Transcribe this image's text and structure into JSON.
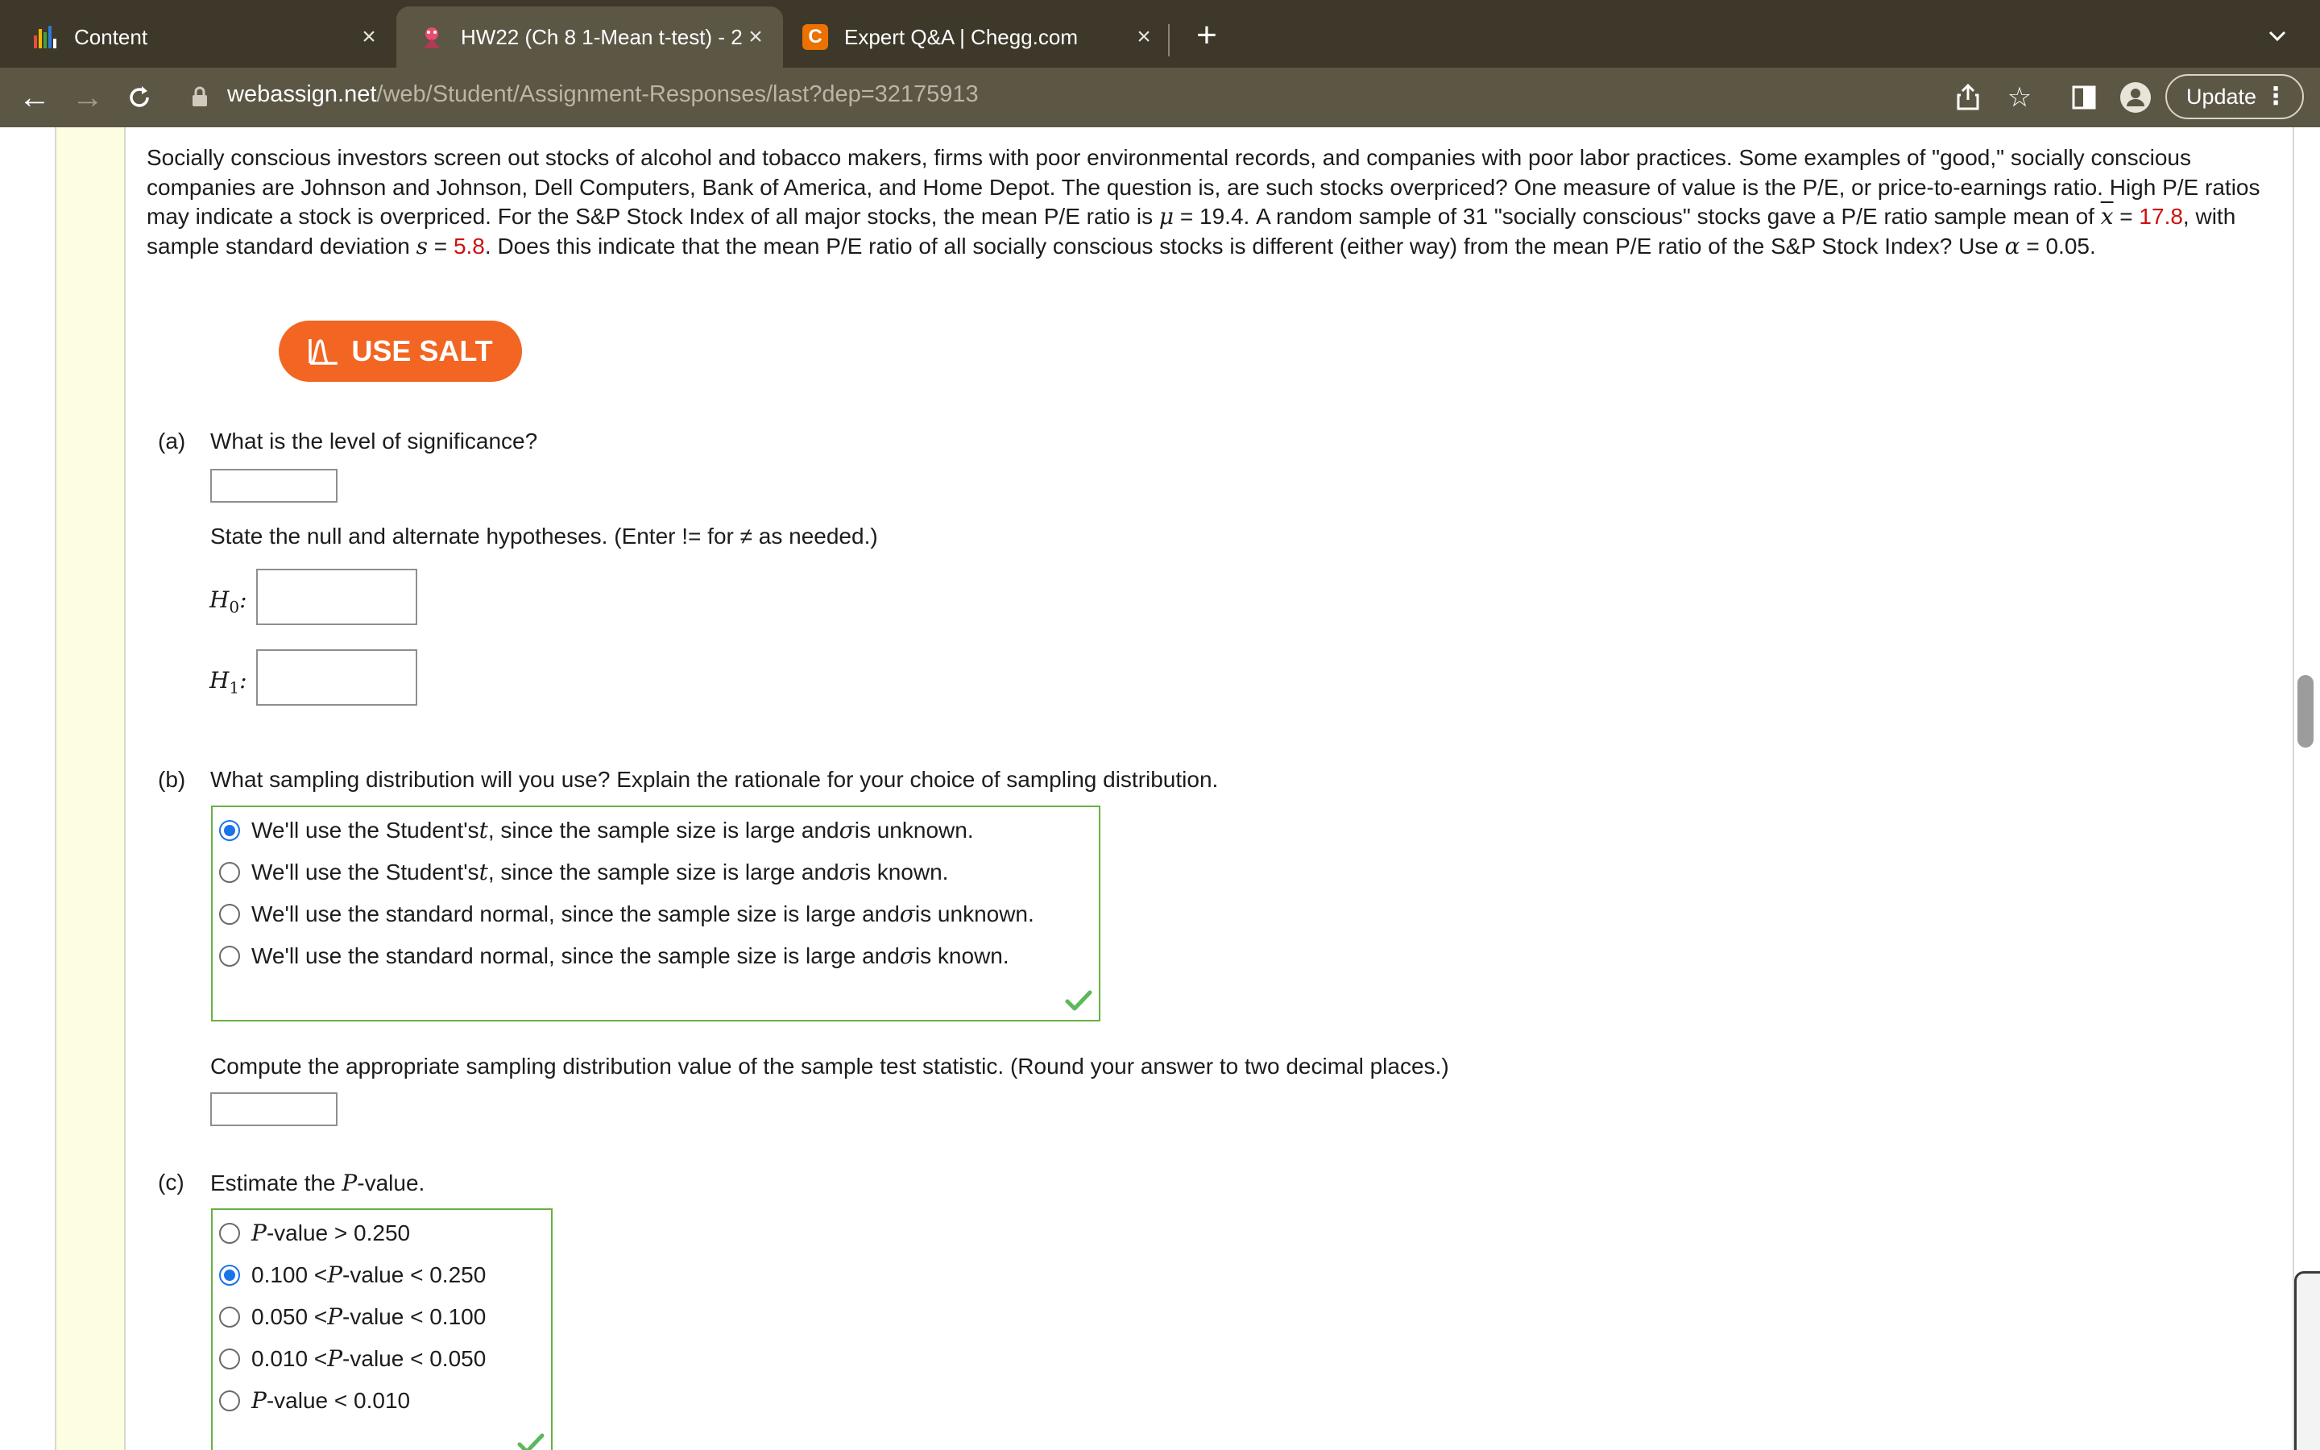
{
  "browser": {
    "tabs": [
      {
        "title": "Content",
        "active": false
      },
      {
        "title": "HW22 (Ch 8 1-Mean t-test) - 2",
        "active": true
      },
      {
        "title": "Expert Q&A | Chegg.com",
        "active": false
      }
    ],
    "url_host": "webassign.net",
    "url_path": "/web/Student/Assignment-Responses/last?dep=32175913",
    "update_label": "Update",
    "chegg_favicon_letter": "C"
  },
  "question": {
    "p1": "Socially conscious investors screen out stocks of alcohol and tobacco makers, firms with poor environmental records, and companies with poor labor practices. Some examples of \"good,\" socially conscious companies are Johnson and Johnson, Dell Computers, Bank of America, and Home Depot. The question is, are such stocks overpriced? One measure of value is the P/E, or price-to-earnings ratio. High P/E ratios may indicate a stock is overpriced. For the S&P Stock Index of all major stocks, the mean P/E ratio is ",
    "mu_symbol": "μ",
    "p2": " = 19.4. A random sample of 31 \"socially conscious\" stocks gave a P/E ratio sample mean of ",
    "xbar_symbol": "x",
    "p3": " = ",
    "xbar_value": "17.8",
    "p4": ", with sample standard deviation ",
    "s_symbol": "s",
    "p5": " = ",
    "s_value": "5.8",
    "p6": ". Does this indicate that the mean P/E ratio of all socially conscious stocks is different (either way) from the mean P/E ratio of the S&P Stock Index? Use ",
    "alpha_symbol": "α",
    "p7": " = 0.05."
  },
  "salt_label": "USE SALT",
  "part_a": {
    "label": "(a)",
    "question": "What is the level of significance?",
    "significance_value": "",
    "hyp_instruction": "State the null and alternate hypotheses. (Enter != for ≠ as needed.)",
    "h0_label": "H",
    "h0_sub": "0",
    "h0_value": "",
    "h1_label": "H",
    "h1_sub": "1",
    "h1_value": ""
  },
  "part_b": {
    "label": "(b)",
    "question": "What sampling distribution will you use? Explain the rationale for your choice of sampling distribution.",
    "options": [
      {
        "pre": "We'll use the Student's ",
        "var": "t",
        "post": ", since the sample size is large and ",
        "sigma": "σ",
        "end": " is unknown.",
        "selected": true
      },
      {
        "pre": "We'll use the Student's ",
        "var": "t",
        "post": ", since the sample size is large and ",
        "sigma": "σ",
        "end": " is known.",
        "selected": false
      },
      {
        "pre": "We'll use the standard normal, since the sample size is large and ",
        "var": "",
        "post": "",
        "sigma": "σ",
        "end": " is unknown.",
        "selected": false
      },
      {
        "pre": "We'll use the standard normal, since the sample size is large and ",
        "var": "",
        "post": "",
        "sigma": "σ",
        "end": " is known.",
        "selected": false
      }
    ],
    "compute_text": "Compute the appropriate sampling distribution value of the sample test statistic. (Round your answer to two decimal places.)",
    "statistic_value": ""
  },
  "part_c": {
    "label": "(c)",
    "question_pre": "Estimate the ",
    "question_var": "P",
    "question_post": "-value.",
    "options": [
      {
        "pre": "",
        "var": "P",
        "post": "-value > 0.250",
        "selected": false
      },
      {
        "pre": "0.100 < ",
        "var": "P",
        "post": "-value < 0.250",
        "selected": true
      },
      {
        "pre": "0.050 < ",
        "var": "P",
        "post": "-value < 0.100",
        "selected": false
      },
      {
        "pre": "0.010 < ",
        "var": "P",
        "post": "-value < 0.050",
        "selected": false
      },
      {
        "pre": "",
        "var": "P",
        "post": "-value < 0.010",
        "selected": false
      }
    ]
  },
  "colors": {
    "tabbar": "#3d3829",
    "toolbar": "#5c5645",
    "salt": "#f26522",
    "given_values": "#cc1111",
    "correct_border": "#68b044",
    "radio_selected": "#1a73e8"
  }
}
